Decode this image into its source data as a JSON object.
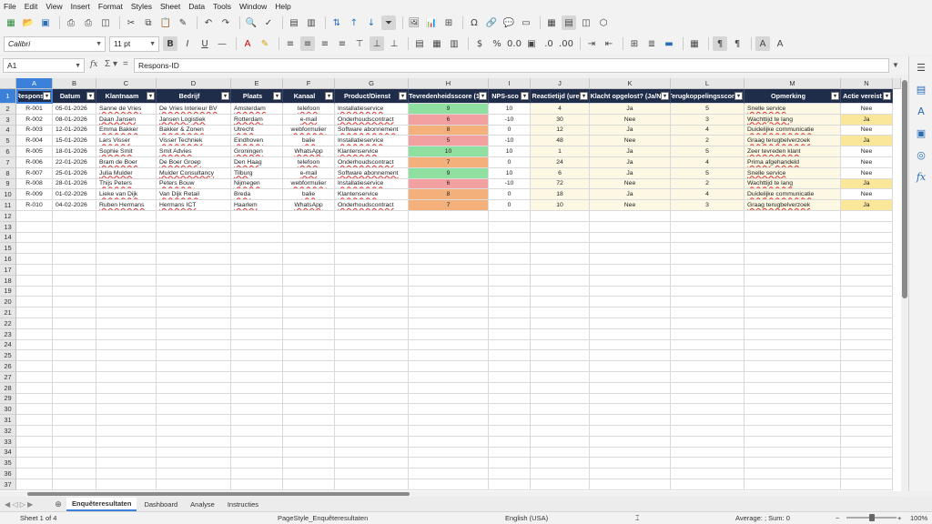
{
  "menu": [
    "File",
    "Edit",
    "View",
    "Insert",
    "Format",
    "Styles",
    "Sheet",
    "Data",
    "Tools",
    "Window",
    "Help"
  ],
  "font": {
    "name": "Calibri",
    "size": "11 pt"
  },
  "formula": {
    "cell_ref": "A1",
    "content": "Respons-ID"
  },
  "columns": [
    "A",
    "B",
    "C",
    "D",
    "E",
    "F",
    "G",
    "H",
    "I",
    "J",
    "K",
    "L",
    "M",
    "N"
  ],
  "headers": [
    "Respons",
    "Datum",
    "Klantnaam",
    "Bedrijf",
    "Plaats",
    "Kanaal",
    "Product/Dienst",
    "Tevredenheidsscore (1",
    "NPS-sco",
    "Reactietijd (ure",
    "Klacht opgelost? (Ja/N",
    "Terugkoppelingsscore",
    "Opmerking",
    "Actie vereist"
  ],
  "rows": [
    [
      "R-001",
      "05-01-2026",
      "Sanne de Vries",
      "De Vries Interieur BV",
      "Amsterdam",
      "telefoon",
      "Installatieservice",
      "9",
      "10",
      "4",
      "Ja",
      "5",
      "Snelle service",
      "Nee"
    ],
    [
      "R-002",
      "08-01-2026",
      "Daan Jansen",
      "Jansen Logistiek",
      "Rotterdam",
      "e-mail",
      "Onderhoudscontract",
      "6",
      "-10",
      "30",
      "Nee",
      "3",
      "Wachttijd te lang",
      "Ja"
    ],
    [
      "R-003",
      "12-01-2026",
      "Emma Bakker",
      "Bakker & Zonen",
      "Utrecht",
      "webformulier",
      "Software abonnement",
      "8",
      "0",
      "12",
      "Ja",
      "4",
      "Duidelijke communicatie",
      "Nee"
    ],
    [
      "R-004",
      "15-01-2026",
      "Lars Visser",
      "Visser Techniek",
      "Eindhoven",
      "balie",
      "Installatieservice",
      "5",
      "-10",
      "48",
      "Nee",
      "2",
      "Graag terugbelverzoek",
      "Ja"
    ],
    [
      "R-005",
      "18-01-2026",
      "Sophie Smit",
      "Smit Advies",
      "Groningen",
      "WhatsApp",
      "Klantenservice",
      "10",
      "10",
      "1",
      "Ja",
      "5",
      "Zeer tevreden klant",
      "Nee"
    ],
    [
      "R-006",
      "22-01-2026",
      "Bram de Boer",
      "De Boer Groep",
      "Den Haag",
      "telefoon",
      "Onderhoudscontract",
      "7",
      "0",
      "24",
      "Ja",
      "4",
      "Prima afgehandeld",
      "Nee"
    ],
    [
      "R-007",
      "25-01-2026",
      "Julia Mulder",
      "Mulder Consultancy",
      "Tilburg",
      "e-mail",
      "Software abonnement",
      "9",
      "10",
      "6",
      "Ja",
      "5",
      "Snelle service",
      "Nee"
    ],
    [
      "R-008",
      "28-01-2026",
      "Thijs Peters",
      "Peters Bouw",
      "Nijmegen",
      "webformulier",
      "Installatieservice",
      "6",
      "-10",
      "72",
      "Nee",
      "2",
      "Wachttijd te lang",
      "Ja"
    ],
    [
      "R-009",
      "01-02-2026",
      "Lieke van Dijk",
      "Van Dijk Retail",
      "Breda",
      "balie",
      "Klantenservice",
      "8",
      "0",
      "18",
      "Ja",
      "4",
      "Duidelijke communicatie",
      "Nee"
    ],
    [
      "R-010",
      "04-02-2026",
      "Ruben Hermans",
      "Hermans ICT",
      "Haarlem",
      "WhatsApp",
      "Onderhoudscontract",
      "7",
      "0",
      "10",
      "Nee",
      "3",
      "Graag terugbelverzoek",
      "Ja"
    ]
  ],
  "score_colors": {
    "high": "#8fe0a0",
    "mid": "#f4b07a",
    "low": "#f3a0a0"
  },
  "tabs": [
    "Enquêteresultaten",
    "Dashboard",
    "Analyse",
    "Instructies"
  ],
  "status": {
    "sheet": "Sheet 1 of 4",
    "pagestyle": "PageStyle_Enquêteresultaten",
    "language": "English (USA)",
    "summary": "Average: ; Sum: 0",
    "zoom": "100%"
  }
}
